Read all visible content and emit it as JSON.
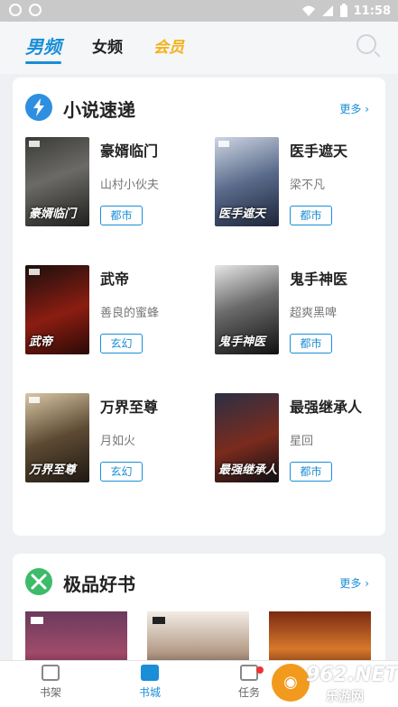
{
  "status_bar": {
    "time": "11:58"
  },
  "top_tabs": [
    {
      "label": "男频",
      "active": true
    },
    {
      "label": "女频",
      "active": false
    },
    {
      "label": "会员",
      "active": false
    }
  ],
  "section1": {
    "title": "小说速递",
    "more": "更多 ›",
    "books": [
      {
        "title": "豪婿临门",
        "author": "山村小伙夫",
        "tag": "都市",
        "cover_text": "豪婿临门"
      },
      {
        "title": "医手遮天",
        "author": "梁不凡",
        "tag": "都市",
        "cover_text": "医手遮天"
      },
      {
        "title": "武帝",
        "author": "善良的蜜蜂",
        "tag": "玄幻",
        "cover_text": "武帝"
      },
      {
        "title": "鬼手神医",
        "author": "超爽黑啤",
        "tag": "都市",
        "cover_text": "鬼手神医"
      },
      {
        "title": "万界至尊",
        "author": "月如火",
        "tag": "玄幻",
        "cover_text": "万界至尊"
      },
      {
        "title": "最强继承人",
        "author": "星回",
        "tag": "都市",
        "cover_text": "最强继承人"
      }
    ]
  },
  "section2": {
    "title": "极品好书",
    "more": "更多 ›"
  },
  "bottom_nav": [
    {
      "label": "书架",
      "icon": "bookshelf-icon",
      "active": false
    },
    {
      "label": "书城",
      "icon": "bookstore-icon",
      "active": true
    },
    {
      "label": "任务",
      "icon": "task-icon",
      "active": false
    }
  ],
  "watermark": {
    "number": "962",
    "suffix": ".NET",
    "cn": "乐游网"
  },
  "colors": {
    "accent": "#1a8ed6",
    "vip": "#f4b21a",
    "lightning": "#2e8fe0",
    "swords": "#3dbb6a"
  }
}
